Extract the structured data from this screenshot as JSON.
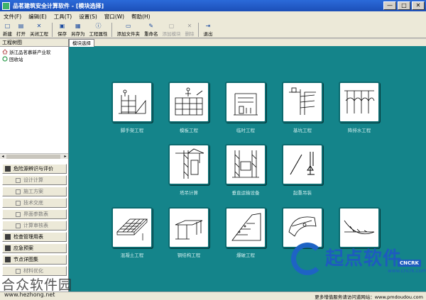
{
  "window": {
    "title": "品茗建筑安全计算软件 - [模块选择]",
    "buttons": [
      "—",
      "□",
      "✕"
    ]
  },
  "menu": [
    "文件(F)",
    "编辑(E)",
    "工具(T)",
    "设置(S)",
    "窗口(W)",
    "帮助(H)"
  ],
  "toolbar": [
    {
      "label": "新建",
      "icon": "□"
    },
    {
      "label": "打开",
      "icon": "▤"
    },
    {
      "label": "关闭工程",
      "icon": "✕"
    },
    {
      "label": "保存",
      "icon": "▣"
    },
    {
      "label": "另存为",
      "icon": "▦"
    },
    {
      "label": "工程属性",
      "icon": "ⓘ"
    },
    {
      "label": "添加文件夹",
      "icon": "▭"
    },
    {
      "label": "重命名",
      "icon": "✎"
    },
    {
      "label": "添加模块",
      "icon": "▢"
    },
    {
      "label": "删除",
      "icon": "✕"
    },
    {
      "label": "退出",
      "icon": "⇥"
    }
  ],
  "left_panel": {
    "header": "工程树图",
    "tree": [
      {
        "label": "浙江品茗慕新产业软"
      },
      {
        "label": "回收站"
      }
    ],
    "categories": [
      {
        "label": "危险源辨识与评价",
        "type": "main"
      },
      {
        "label": "设计计算",
        "type": "sub"
      },
      {
        "label": "施工方案",
        "type": "sub"
      },
      {
        "label": "技术交底",
        "type": "sub"
      },
      {
        "label": "界面参数表",
        "type": "sub"
      },
      {
        "label": "计算审核表",
        "type": "sub"
      },
      {
        "label": "检查管理用表",
        "type": "main"
      },
      {
        "label": "应急预案",
        "type": "main"
      },
      {
        "label": "节点详图集",
        "type": "main"
      },
      {
        "label": "材料优化",
        "type": "sub"
      }
    ]
  },
  "main": {
    "tab": "模块选择",
    "modules": [
      {
        "label": "脚手架工程",
        "icon": "scaffold-icon"
      },
      {
        "label": "模板工程",
        "icon": "formwork-icon"
      },
      {
        "label": "临时工程",
        "icon": "temporary-icon"
      },
      {
        "label": "基坑工程",
        "icon": "foundation-pit-icon"
      },
      {
        "label": "降排水工程",
        "icon": "dewatering-icon"
      },
      {
        "label": "塔吊计算",
        "icon": "tower-crane-icon"
      },
      {
        "label": "垂直运输设备",
        "icon": "hoist-icon"
      },
      {
        "label": "起重吊装",
        "icon": "lifting-icon"
      },
      {
        "label": "混凝土工程",
        "icon": "concrete-icon"
      },
      {
        "label": "钢结构工程",
        "icon": "steel-icon"
      },
      {
        "label": "爆破工程",
        "icon": "blasting-icon"
      },
      {
        "label": "",
        "icon": "tunnel-icon"
      },
      {
        "label": "",
        "icon": "bridge-icon"
      }
    ]
  },
  "status": {
    "text": "更多增值服务请访问道网站：www.pmdoudou.com"
  },
  "watermark": {
    "site_name": "合众软件园",
    "site_url": "www.hezhong.net",
    "brand": "起点软件",
    "badge": "CNCRK",
    "brand_domain": "www.cncrk.com"
  },
  "colors": {
    "workspace": "#14848a",
    "titlebar": "#2b6ad9",
    "brand": "#1e5bbf"
  }
}
